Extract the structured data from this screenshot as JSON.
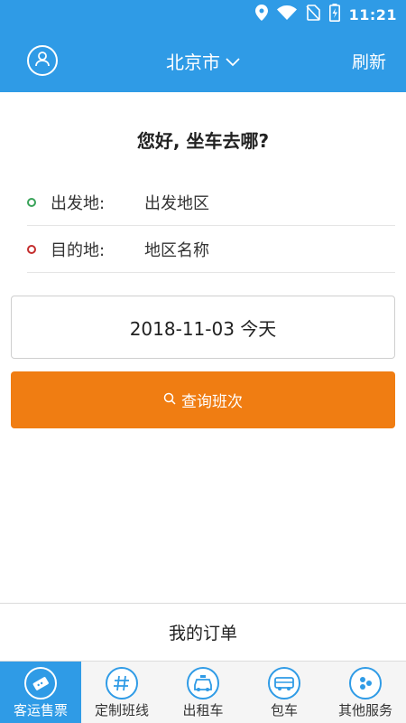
{
  "status": {
    "time": "11:21",
    "icons": [
      "location-icon",
      "wifi-icon",
      "no-sim-icon",
      "battery-icon"
    ]
  },
  "header": {
    "city": "北京市",
    "refresh_label": "刷新",
    "avatar_icon": "user-icon"
  },
  "main": {
    "greeting": "您好, 坐车去哪?",
    "route": [
      {
        "label": "出发地:",
        "value": "出发地区",
        "dot_color": "#3aa35a"
      },
      {
        "label": "目的地:",
        "value": "地区名称",
        "dot_color": "#c42e2e"
      }
    ],
    "date": "2018-11-03 今天",
    "search_label": "查询班次",
    "my_orders_label": "我的订单"
  },
  "bottom_nav": [
    {
      "label": "客运售票",
      "icon": "ticket-icon",
      "active": true
    },
    {
      "label": "定制班线",
      "icon": "route-icon",
      "active": false
    },
    {
      "label": "出租车",
      "icon": "taxi-icon",
      "active": false
    },
    {
      "label": "包车",
      "icon": "bus-icon",
      "active": false
    },
    {
      "label": "其他服务",
      "icon": "more-services-icon",
      "active": false
    }
  ],
  "colors": {
    "primary": "#2f9be6",
    "accent": "#f07d12",
    "start_dot": "#3aa35a",
    "end_dot": "#c42e2e"
  }
}
